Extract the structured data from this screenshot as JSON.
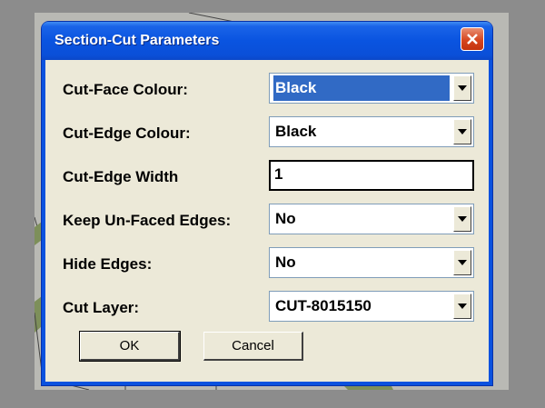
{
  "window": {
    "title": "Section-Cut Parameters",
    "close_icon": "close-icon"
  },
  "fields": [
    {
      "label": "Cut-Face Colour:",
      "type": "dropdown",
      "value": "Black",
      "selected": true
    },
    {
      "label": "Cut-Edge Colour:",
      "type": "dropdown",
      "value": "Black"
    },
    {
      "label": "Cut-Edge Width",
      "type": "text",
      "value": "1"
    },
    {
      "label": "Keep Un-Faced Edges:",
      "type": "dropdown",
      "value": "No"
    },
    {
      "label": "Hide Edges:",
      "type": "dropdown",
      "value": "No"
    },
    {
      "label": "Cut Layer:",
      "type": "dropdown",
      "value": "CUT-8015150"
    }
  ],
  "buttons": {
    "ok": "OK",
    "cancel": "Cancel"
  },
  "colors": {
    "titlebar": "#0a54e0",
    "client_bg": "#ece9d8",
    "selection": "#316ac5",
    "close_button": "#d6461f"
  }
}
